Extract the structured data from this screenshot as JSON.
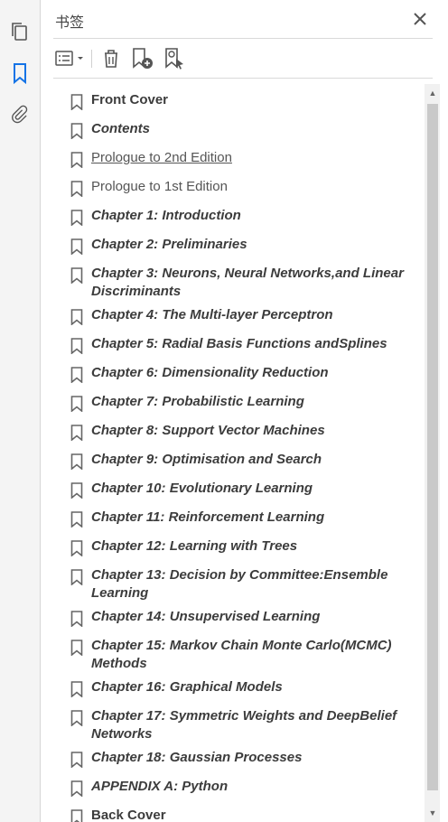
{
  "panel": {
    "title": "书签"
  },
  "bookmarks": [
    {
      "label": "Front Cover",
      "style": "b"
    },
    {
      "label": "Contents",
      "style": "bi"
    },
    {
      "label": "Prologue to 2nd Edition",
      "style": "n u"
    },
    {
      "label": "Prologue to 1st Edition",
      "style": "n"
    },
    {
      "label": "Chapter 1: Introduction",
      "style": "bi"
    },
    {
      "label": " Chapter 2: Preliminaries",
      "style": "bi"
    },
    {
      "label": "Chapter 3: Neurons, Neural Networks,and Linear Discriminants",
      "style": "bi"
    },
    {
      "label": "Chapter 4: The Multi-layer Perceptron",
      "style": "bi"
    },
    {
      "label": "Chapter 5: Radial Basis Functions andSplines",
      "style": "bi"
    },
    {
      "label": "Chapter 6: Dimensionality Reduction",
      "style": "bi"
    },
    {
      "label": "Chapter 7: Probabilistic Learning",
      "style": "bi"
    },
    {
      "label": "Chapter 8: Support Vector Machines",
      "style": "bi"
    },
    {
      "label": "Chapter 9: Optimisation and Search",
      "style": "bi"
    },
    {
      "label": "Chapter 10: Evolutionary Learning",
      "style": "bi"
    },
    {
      "label": "Chapter 11: Reinforcement Learning",
      "style": "bi"
    },
    {
      "label": "Chapter 12:  Learning with Trees",
      "style": "bi"
    },
    {
      "label": "Chapter 13: Decision by Committee:Ensemble Learning",
      "style": "bi"
    },
    {
      "label": "Chapter 14: Unsupervised Learning",
      "style": "bi"
    },
    {
      "label": "Chapter 15: Markov Chain Monte Carlo(MCMC) Methods",
      "style": "bi"
    },
    {
      "label": "Chapter 16: Graphical Models",
      "style": "bi"
    },
    {
      "label": "Chapter 17: Symmetric Weights and DeepBelief Networks",
      "style": "bi"
    },
    {
      "label": "Chapter 18: Gaussian Processes",
      "style": "bi"
    },
    {
      "label": "APPENDIX A: Python",
      "style": "bi"
    },
    {
      "label": "Back Cover",
      "style": "b"
    }
  ]
}
